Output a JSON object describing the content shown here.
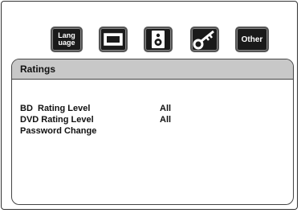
{
  "toolbar": {
    "icons": [
      {
        "name": "language-icon",
        "label_line1": "Lang",
        "label_line2": "uage"
      },
      {
        "name": "display-icon"
      },
      {
        "name": "audio-speaker-icon"
      },
      {
        "name": "key-icon"
      },
      {
        "name": "other-icon",
        "label": "Other"
      }
    ]
  },
  "panel": {
    "title": "Ratings",
    "rows": [
      {
        "label": "BD  Rating Level",
        "value": "All"
      },
      {
        "label": "DVD Rating Level",
        "value": "All"
      },
      {
        "label": "Password Change",
        "value": ""
      }
    ]
  }
}
